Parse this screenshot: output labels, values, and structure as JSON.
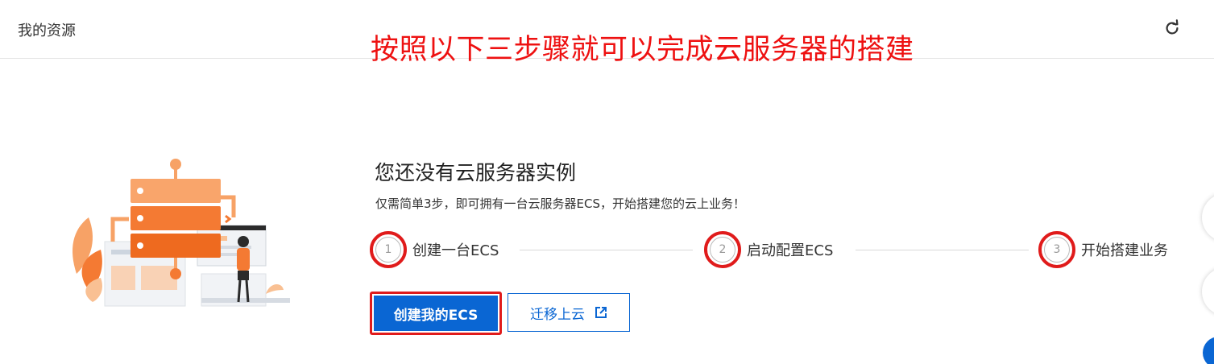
{
  "header": {
    "title": "我的资源",
    "refresh_icon": "refresh-icon"
  },
  "annotation": {
    "text": "按照以下三步骤就可以完成云服务器的搭建",
    "color": "#ee1111"
  },
  "empty_state": {
    "title": "您还没有云服务器实例",
    "subtitle": "仅需简单3步，即可拥有一台云服务器ECS，开始搭建您的云上业务！",
    "illustration": "server-illustration"
  },
  "steps": [
    {
      "number": "1",
      "label": "创建一台ECS"
    },
    {
      "number": "2",
      "label": "启动配置ECS"
    },
    {
      "number": "3",
      "label": "开始搭建业务"
    }
  ],
  "actions": {
    "primary_label": "创建我的ECS",
    "secondary_label": "迁移上云",
    "secondary_icon": "external-link-icon"
  },
  "colors": {
    "primary": "#0a66d3",
    "annotation_red": "#e01b1b",
    "illustration_orange": "#f47a33"
  }
}
